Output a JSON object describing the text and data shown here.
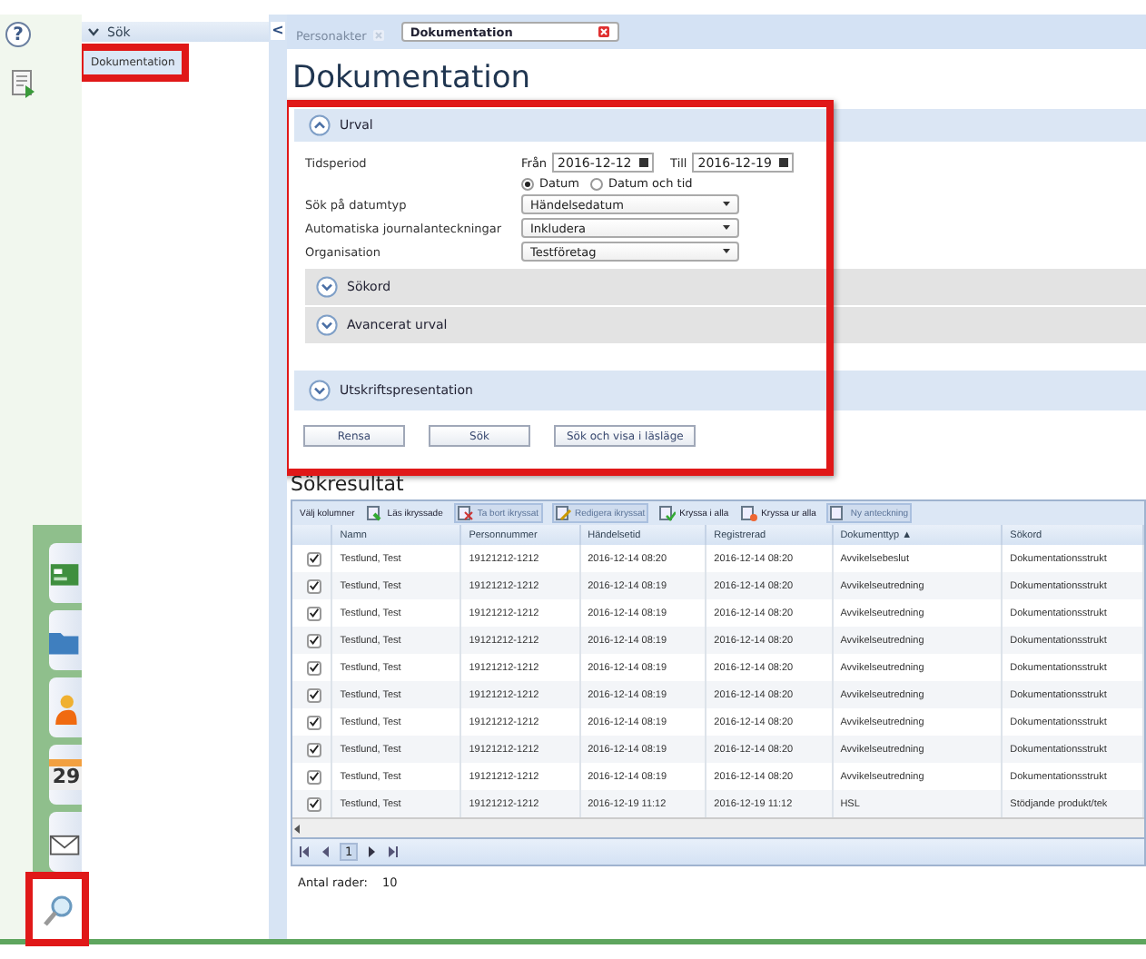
{
  "rail": {
    "help": "?",
    "apps": [
      {
        "kind": "card",
        "selected": false,
        "highlighted": false
      },
      {
        "kind": "folder",
        "selected": false,
        "highlighted": false
      },
      {
        "kind": "person",
        "selected": false,
        "highlighted": false
      },
      {
        "kind": "calendar",
        "text": "29",
        "selected": false,
        "highlighted": false
      },
      {
        "kind": "mail",
        "selected": false,
        "highlighted": false
      },
      {
        "kind": "search",
        "selected": true,
        "highlighted": true
      }
    ]
  },
  "sidebar": {
    "collapse": "<",
    "header": "Sök",
    "expanded": true,
    "items": [
      {
        "label": "Dokumentation",
        "selected": true,
        "highlighted": true
      }
    ]
  },
  "tabs": [
    {
      "label": "Personakter",
      "selected": false
    },
    {
      "label": "Dokumentation",
      "selected": true
    }
  ],
  "page_title": "Dokumentation",
  "filter": {
    "highlighted": true,
    "section": {
      "title": "Urval",
      "expanded": true
    },
    "period_label": "Tidsperiod",
    "from_label": "Från",
    "from": "2016-12-12",
    "to_label": "Till",
    "to": "2016-12-19",
    "date_modes": [
      {
        "label": "Datum",
        "selected": true
      },
      {
        "label": "Datum och tid",
        "selected": false
      }
    ],
    "selects": [
      {
        "label": "Sök på datumtyp",
        "value": "Händelsedatum"
      },
      {
        "label": "Automatiska journalanteckningar",
        "value": "Inkludera"
      },
      {
        "label": "Organisation",
        "value": "Testföretag"
      }
    ],
    "subsections": [
      {
        "title": "Sökord",
        "expanded": false
      },
      {
        "title": "Avancerat urval",
        "expanded": false
      }
    ],
    "print_section": {
      "title": "Utskriftspresentation",
      "expanded": false
    },
    "buttons": [
      "Rensa",
      "Sök",
      "Sök och visa i läsläge"
    ]
  },
  "results": {
    "title": "Sökresultat",
    "toolbar": [
      {
        "label": "Välj kolumner",
        "kind": "text",
        "disabled": false
      },
      {
        "label": "Läs ikryssade",
        "kind": "read",
        "disabled": false
      },
      {
        "label": "Ta bort ikryssat",
        "kind": "delete",
        "disabled": true
      },
      {
        "label": "Redigera ikryssat",
        "kind": "edit",
        "disabled": true
      },
      {
        "label": "Kryssa i alla",
        "kind": "check",
        "disabled": false
      },
      {
        "label": "Kryssa ur alla",
        "kind": "uncheck",
        "disabled": false
      },
      {
        "label": "Ny anteckning",
        "kind": "note",
        "disabled": true
      }
    ],
    "columns": [
      "Namn",
      "Personnummer",
      "Händelsetid",
      "Registrerad",
      "Dokumenttyp ▲",
      "Sökord"
    ],
    "rows": [
      {
        "checked": true,
        "cells": [
          "Testlund, Test",
          "19121212-1212",
          "2016-12-14 08:20",
          "2016-12-14 08:20",
          "Avvikelsebeslut",
          "Dokumentationsstrukt"
        ]
      },
      {
        "checked": true,
        "cells": [
          "Testlund, Test",
          "19121212-1212",
          "2016-12-14 08:19",
          "2016-12-14 08:20",
          "Avvikelseutredning",
          "Dokumentationsstrukt"
        ]
      },
      {
        "checked": true,
        "cells": [
          "Testlund, Test",
          "19121212-1212",
          "2016-12-14 08:19",
          "2016-12-14 08:20",
          "Avvikelseutredning",
          "Dokumentationsstrukt"
        ]
      },
      {
        "checked": true,
        "cells": [
          "Testlund, Test",
          "19121212-1212",
          "2016-12-14 08:19",
          "2016-12-14 08:20",
          "Avvikelseutredning",
          "Dokumentationsstrukt"
        ]
      },
      {
        "checked": true,
        "cells": [
          "Testlund, Test",
          "19121212-1212",
          "2016-12-14 08:19",
          "2016-12-14 08:20",
          "Avvikelseutredning",
          "Dokumentationsstrukt"
        ]
      },
      {
        "checked": true,
        "cells": [
          "Testlund, Test",
          "19121212-1212",
          "2016-12-14 08:19",
          "2016-12-14 08:20",
          "Avvikelseutredning",
          "Dokumentationsstrukt"
        ]
      },
      {
        "checked": true,
        "cells": [
          "Testlund, Test",
          "19121212-1212",
          "2016-12-14 08:19",
          "2016-12-14 08:20",
          "Avvikelseutredning",
          "Dokumentationsstrukt"
        ]
      },
      {
        "checked": true,
        "cells": [
          "Testlund, Test",
          "19121212-1212",
          "2016-12-14 08:19",
          "2016-12-14 08:20",
          "Avvikelseutredning",
          "Dokumentationsstrukt"
        ]
      },
      {
        "checked": true,
        "cells": [
          "Testlund, Test",
          "19121212-1212",
          "2016-12-14 08:19",
          "2016-12-14 08:20",
          "Avvikelseutredning",
          "Dokumentationsstrukt"
        ]
      },
      {
        "checked": true,
        "cells": [
          "Testlund, Test",
          "19121212-1212",
          "2016-12-19 11:12",
          "2016-12-19 11:12",
          "HSL",
          "Stödjande produkt/tek"
        ]
      }
    ],
    "page": "1",
    "row_count_label": "Antal rader:",
    "row_count": "10"
  }
}
